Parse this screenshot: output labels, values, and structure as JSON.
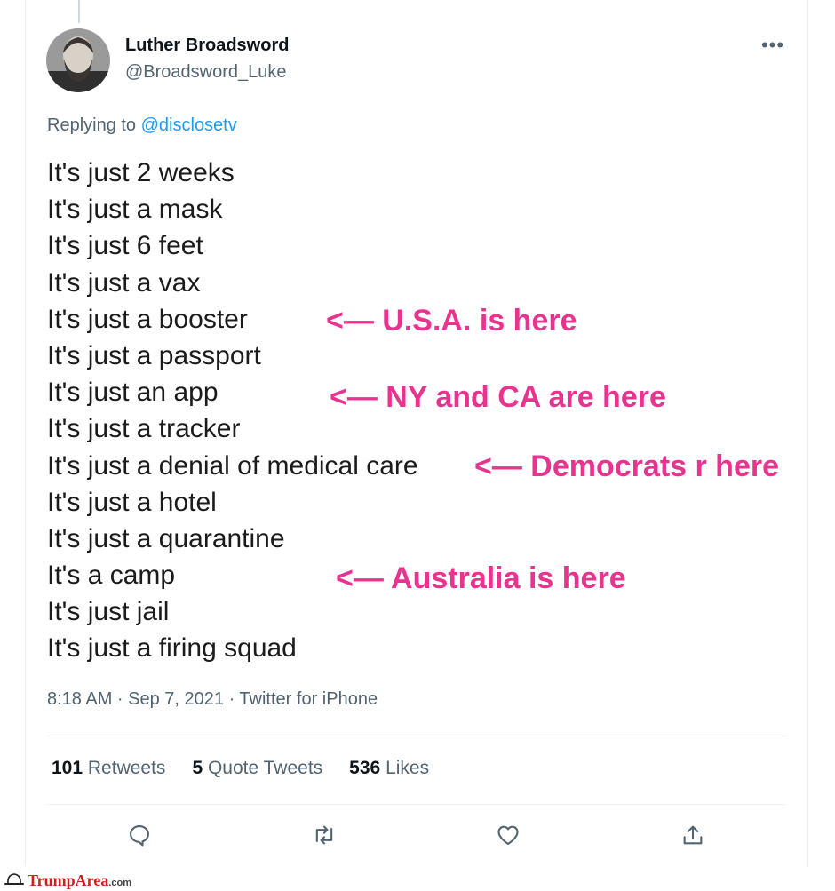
{
  "tweet": {
    "author_name": "Luther Broadsword",
    "author_handle": "@Broadsword_Luke",
    "more_label": "•••",
    "replying_prefix": "Replying to",
    "replying_mention": "@disclosetv",
    "lines": [
      "It's just 2 weeks",
      "It's just a mask",
      "It's just 6 feet",
      "It's just a vax",
      "It's just a booster",
      "It's just a passport",
      "It's just an app",
      "It's just a tracker",
      "It's just a denial of medical care",
      "It's just a hotel",
      "It's just a quarantine",
      "It's a camp",
      "It's just jail",
      "It's just a firing squad"
    ],
    "timestamp": "8:18 AM · Sep 7, 2021 · Twitter for iPhone"
  },
  "annotations": [
    {
      "text": "<— U.S.A. is here"
    },
    {
      "text": "<— NY and CA are here"
    },
    {
      "text": "<— Democrats r here"
    },
    {
      "text": "<— Australia is here"
    }
  ],
  "annotation_color": "#e8338f",
  "stats": [
    {
      "count": "101",
      "label": "Retweets"
    },
    {
      "count": "5",
      "label": "Quote Tweets"
    },
    {
      "count": "536",
      "label": "Likes"
    }
  ],
  "actions": [
    {
      "icon": "reply-icon"
    },
    {
      "icon": "retweet-icon"
    },
    {
      "icon": "like-icon"
    },
    {
      "icon": "share-icon"
    }
  ],
  "watermark": {
    "brand": "TrumpArea",
    "suffix": ".com",
    "icon": "hat-icon"
  }
}
